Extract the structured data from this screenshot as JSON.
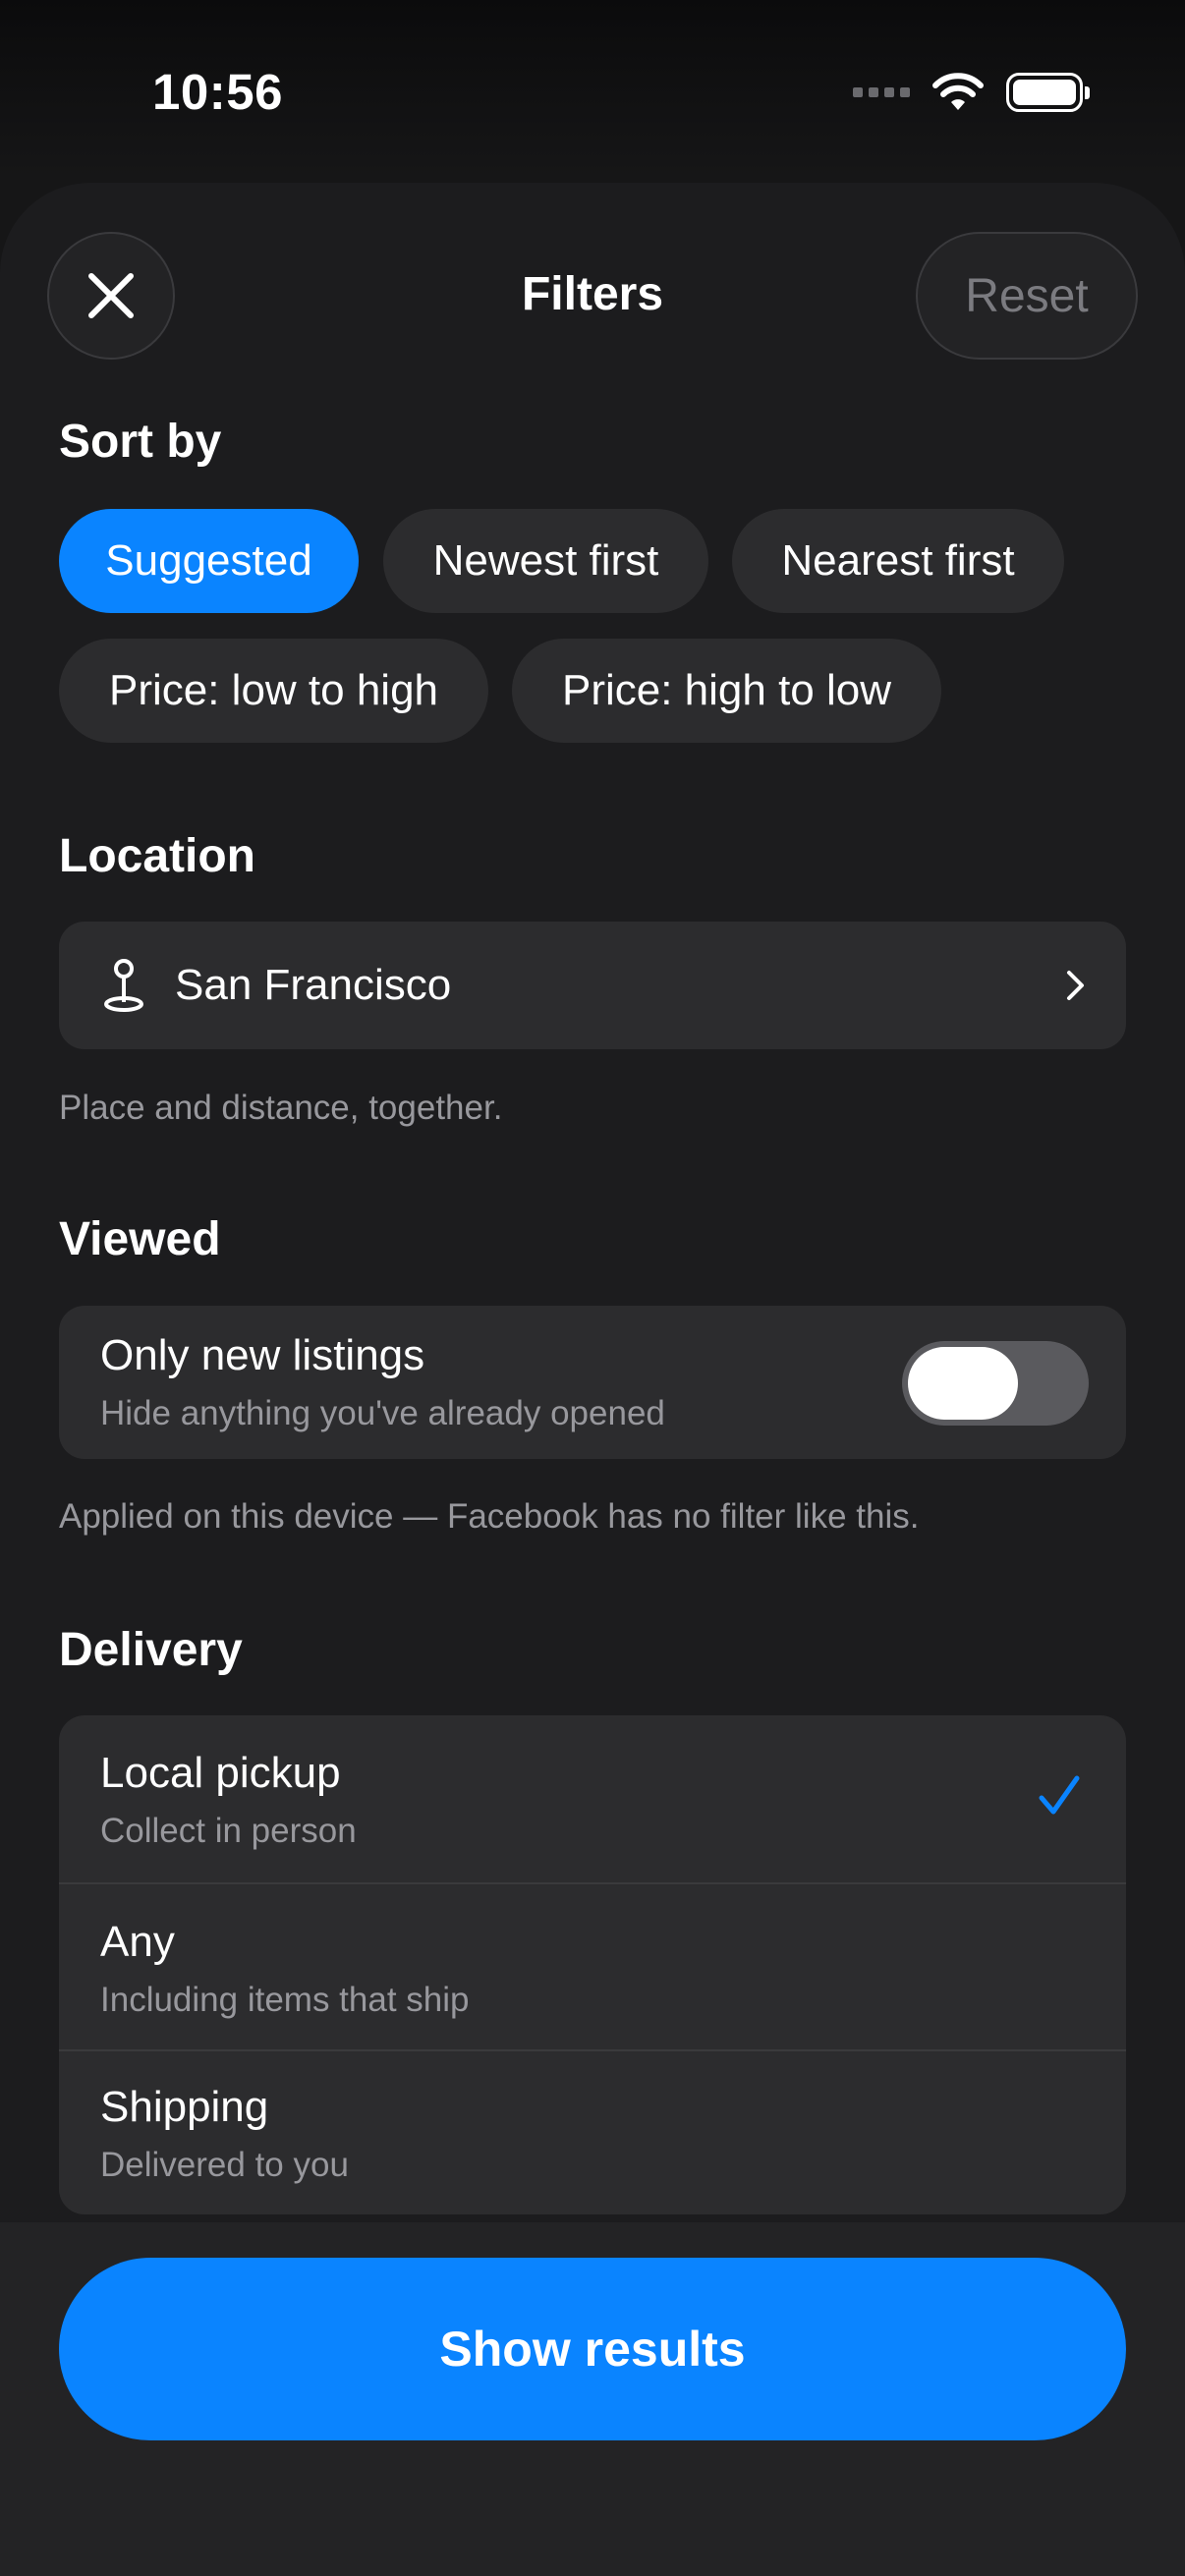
{
  "status_bar": {
    "time": "10:56"
  },
  "header": {
    "title": "Filters",
    "reset_label": "Reset"
  },
  "sort": {
    "title": "Sort by",
    "options": [
      "Suggested",
      "Newest first",
      "Nearest first",
      "Price: low to high",
      "Price: high to low"
    ],
    "selected": "Suggested"
  },
  "location": {
    "title": "Location",
    "value": "San Francisco",
    "caption": "Place and distance, together."
  },
  "viewed": {
    "title": "Viewed",
    "toggle_title": "Only new listings",
    "toggle_subtitle": "Hide anything you've already opened",
    "toggle_on": false,
    "caption": "Applied on this device — Facebook has no filter like this."
  },
  "delivery": {
    "title": "Delivery",
    "options": [
      {
        "title": "Local pickup",
        "subtitle": "Collect in person",
        "selected": true
      },
      {
        "title": "Any",
        "subtitle": "Including items that ship",
        "selected": false
      },
      {
        "title": "Shipping",
        "subtitle": "Delivered to you",
        "selected": false
      }
    ]
  },
  "footer": {
    "button_label": "Show results"
  },
  "colors": {
    "accent": "#0a84ff",
    "sheet_bg": "#1c1c1e",
    "card_bg": "#2c2c2e"
  }
}
